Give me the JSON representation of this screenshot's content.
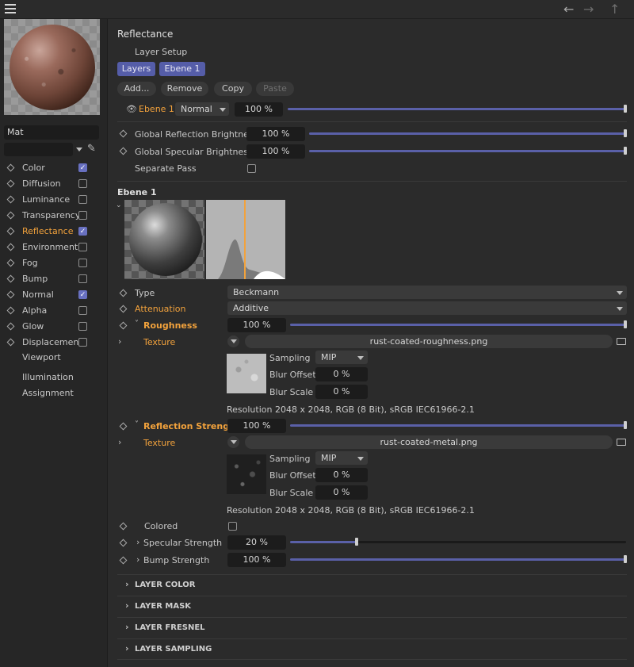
{
  "toolbar": {
    "menu_icon": "hamburger-icon",
    "back_icon": "arrow-left-icon",
    "forward_icon": "arrow-right-icon",
    "up_icon": "arrow-up-icon"
  },
  "left": {
    "material_name": "Mat",
    "channels": [
      {
        "label": "Color",
        "checked": true,
        "active": false
      },
      {
        "label": "Diffusion",
        "checked": false,
        "active": false
      },
      {
        "label": "Luminance",
        "checked": false,
        "active": false
      },
      {
        "label": "Transparency",
        "checked": false,
        "active": false
      },
      {
        "label": "Reflectance",
        "checked": true,
        "active": true
      },
      {
        "label": "Environment",
        "checked": false,
        "active": false
      },
      {
        "label": "Fog",
        "checked": false,
        "active": false
      },
      {
        "label": "Bump",
        "checked": false,
        "active": false
      },
      {
        "label": "Normal",
        "checked": true,
        "active": false
      },
      {
        "label": "Alpha",
        "checked": false,
        "active": false
      },
      {
        "label": "Glow",
        "checked": false,
        "active": false
      },
      {
        "label": "Displacement",
        "checked": false,
        "active": false
      }
    ],
    "extra": [
      "Viewport",
      "Illumination",
      "Assignment"
    ]
  },
  "main": {
    "title": "Reflectance",
    "layer_setup": "Layer Setup",
    "tabs": [
      "Layers",
      "Ebene 1"
    ],
    "buttons": [
      "Add...",
      "Remove",
      "Copy",
      "Paste"
    ],
    "layer_row": {
      "name": "Ebene 1",
      "mode": "Normal",
      "value": "100 %",
      "fraction": 1.0
    },
    "global": [
      {
        "label": "Global Reflection Brightness",
        "value": "100 %",
        "fraction": 1.0
      },
      {
        "label": "Global Specular Brightness",
        "value": "100 %",
        "fraction": 1.0
      }
    ],
    "separate_pass": "Separate Pass",
    "layer_title": "Ebene 1",
    "type_label": "Type",
    "type_value": "Beckmann",
    "attenuation_label": "Attenuation",
    "attenuation_value": "Additive",
    "roughness": {
      "label": "Roughness",
      "value": "100 %",
      "fraction": 1.0,
      "texture_label": "Texture",
      "file": "rust-coated-roughness.png",
      "sampling_label": "Sampling",
      "sampling": "MIP",
      "blur_offset_label": "Blur Offset",
      "blur_offset": "0 %",
      "blur_scale_label": "Blur Scale",
      "blur_scale": "0 %",
      "resolution": "Resolution 2048 x 2048, RGB (8 Bit), sRGB IEC61966-2.1"
    },
    "reflection_strength": {
      "label": "Reflection Strength",
      "value": "100 %",
      "fraction": 1.0,
      "texture_label": "Texture",
      "file": "rust-coated-metal.png",
      "sampling_label": "Sampling",
      "sampling": "MIP",
      "blur_offset_label": "Blur Offset",
      "blur_offset": "0 %",
      "blur_scale_label": "Blur Scale",
      "blur_scale": "0 %",
      "resolution": "Resolution 2048 x 2048, RGB (8 Bit), sRGB IEC61966-2.1"
    },
    "colored_label": "Colored",
    "specular": {
      "label": "Specular Strength",
      "value": "20 %",
      "fraction": 0.2
    },
    "bump": {
      "label": "Bump Strength",
      "value": "100 %",
      "fraction": 1.0
    },
    "sections": [
      "LAYER COLOR",
      "LAYER MASK",
      "LAYER FRESNEL",
      "LAYER SAMPLING"
    ]
  },
  "colors": {
    "accent": "#555da8",
    "orange": "#f2a23c",
    "bg": "#2b2b2b"
  }
}
